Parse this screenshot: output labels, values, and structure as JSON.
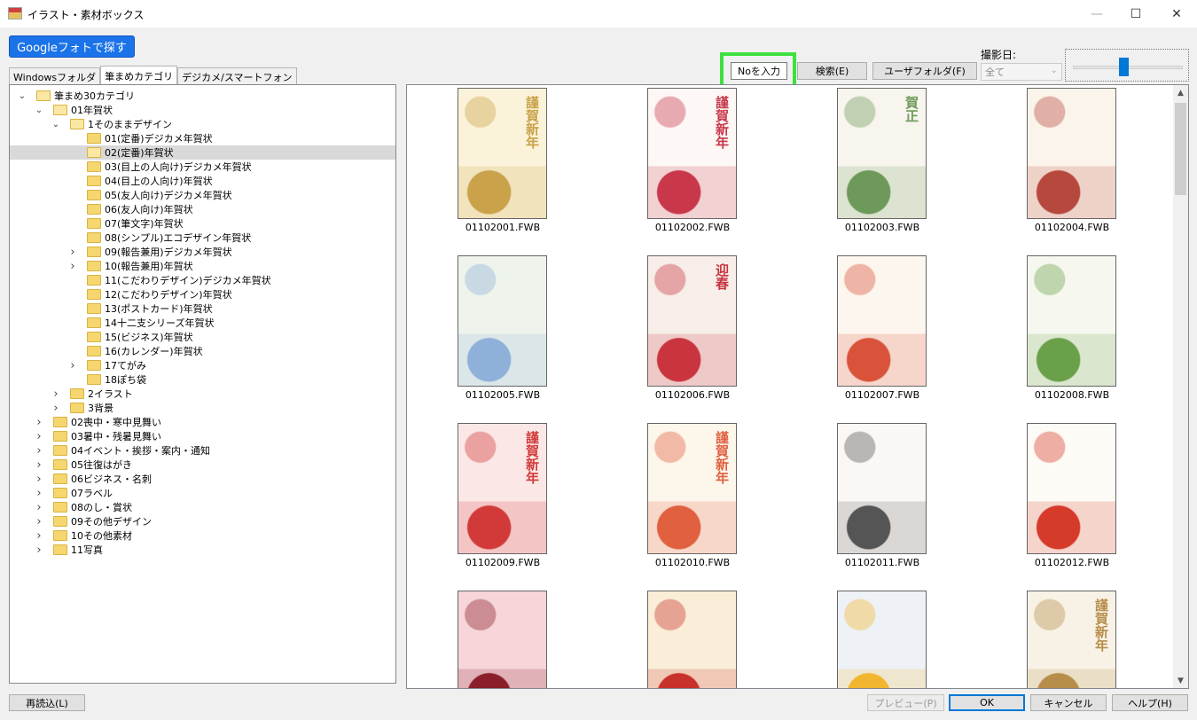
{
  "window": {
    "title": "イラスト・素材ボックス",
    "minimize": "—",
    "maximize": "☐",
    "close": "✕"
  },
  "google_button": "Googleフォトで探す",
  "tabs": [
    {
      "label": "Windowsフォルダ"
    },
    {
      "label": "筆まめカテゴリ"
    },
    {
      "label": "デジカメ/スマートフォン"
    }
  ],
  "toolbar": {
    "no_input_value": "Noを入力",
    "search_label": "検索(E)",
    "userfolder_label": "ユーザフォルダ(F)",
    "date_label": "撮影日:",
    "date_value": "全て",
    "highlight_color": "#3ee03e"
  },
  "tree": [
    {
      "label": "筆まめ30カテゴリ",
      "level": 0,
      "expanded": true
    },
    {
      "label": "01年賀状",
      "level": 1,
      "expanded": true
    },
    {
      "label": "1そのままデザイン",
      "level": 2,
      "expanded": true
    },
    {
      "label": "01(定番)デジカメ年賀状",
      "level": 3
    },
    {
      "label": "02(定番)年賀状",
      "level": 3,
      "selected": true
    },
    {
      "label": "03(目上の人向け)デジカメ年賀状",
      "level": 3
    },
    {
      "label": "04(目上の人向け)年賀状",
      "level": 3
    },
    {
      "label": "05(友人向け)デジカメ年賀状",
      "level": 3
    },
    {
      "label": "06(友人向け)年賀状",
      "level": 3
    },
    {
      "label": "07(筆文字)年賀状",
      "level": 3
    },
    {
      "label": "08(シンプル)エコデザイン年賀状",
      "level": 3
    },
    {
      "label": "09(報告兼用)デジカメ年賀状",
      "level": 3,
      "expandable": true
    },
    {
      "label": "10(報告兼用)年賀状",
      "level": 3,
      "expandable": true
    },
    {
      "label": "11(こだわりデザイン)デジカメ年賀状",
      "level": 3
    },
    {
      "label": "12(こだわりデザイン)年賀状",
      "level": 3
    },
    {
      "label": "13(ポストカード)年賀状",
      "level": 3
    },
    {
      "label": "14十二支シリーズ年賀状",
      "level": 3
    },
    {
      "label": "15(ビジネス)年賀状",
      "level": 3
    },
    {
      "label": "16(カレンダー)年賀状",
      "level": 3
    },
    {
      "label": "17てがみ",
      "level": 3,
      "expandable": true
    },
    {
      "label": "18ぽち袋",
      "level": 3
    },
    {
      "label": "2イラスト",
      "level": 2,
      "expandable": true
    },
    {
      "label": "3背景",
      "level": 2,
      "expandable": true
    },
    {
      "label": "02喪中・寒中見舞い",
      "level": 1,
      "expandable": true
    },
    {
      "label": "03暑中・残暑見舞い",
      "level": 1,
      "expandable": true
    },
    {
      "label": "04イベント・挨拶・案内・通知",
      "level": 1,
      "expandable": true
    },
    {
      "label": "05往復はがき",
      "level": 1,
      "expandable": true
    },
    {
      "label": "06ビジネス・名刺",
      "level": 1,
      "expandable": true
    },
    {
      "label": "07ラベル",
      "level": 1,
      "expandable": true
    },
    {
      "label": "08のし・賞状",
      "level": 1,
      "expandable": true
    },
    {
      "label": "09その他デザイン",
      "level": 1,
      "expandable": true
    },
    {
      "label": "10その他素材",
      "level": 1,
      "expandable": true
    },
    {
      "label": "11写真",
      "level": 1,
      "expandable": true
    }
  ],
  "thumbnails": [
    {
      "name": "01102001.FWB",
      "title": "謹賀新年",
      "bg": "#fbf3d9",
      "accent": "#c9a24a"
    },
    {
      "name": "01102002.FWB",
      "title": "謹賀新年",
      "bg": "#fdf7f5",
      "accent": "#c8384a"
    },
    {
      "name": "01102003.FWB",
      "title": "賀正",
      "bg": "#f7f5ee",
      "accent": "#6d9a5a"
    },
    {
      "name": "01102004.FWB",
      "title": "",
      "bg": "#fbf4ea",
      "accent": "#b7483e"
    },
    {
      "name": "01102005.FWB",
      "title": "",
      "bg": "#eef4ec",
      "accent": "#8fb0d8"
    },
    {
      "name": "01102006.FWB",
      "title": "迎春",
      "bg": "#f8eee9",
      "accent": "#c9343f"
    },
    {
      "name": "01102007.FWB",
      "title": "",
      "bg": "#fdf6ee",
      "accent": "#d8533a"
    },
    {
      "name": "01102008.FWB",
      "title": "",
      "bg": "#f6f8ef",
      "accent": "#6aa04a"
    },
    {
      "name": "01102009.FWB",
      "title": "謹賀新年",
      "bg": "#fbe8e6",
      "accent": "#d23a3a"
    },
    {
      "name": "01102010.FWB",
      "title": "謹賀新年",
      "bg": "#fdf6ea",
      "accent": "#e06040"
    },
    {
      "name": "01102011.FWB",
      "title": "",
      "bg": "#fbf7f4",
      "accent": "#555555"
    },
    {
      "name": "01102012.FWB",
      "title": "",
      "bg": "#fdfbf5",
      "accent": "#d63a2a"
    },
    {
      "name": "",
      "title": "",
      "bg": "#f6d6d9",
      "accent": "#8a1e2a"
    },
    {
      "name": "",
      "title": "",
      "bg": "#faeed8",
      "accent": "#c8302a"
    },
    {
      "name": "",
      "title": "",
      "bg": "#eef2f7",
      "accent": "#f2b52f"
    },
    {
      "name": "",
      "title": "謹賀新年",
      "bg": "#f8f2e6",
      "accent": "#b78d4a"
    }
  ],
  "buttons": {
    "reload": "再読込(L)",
    "preview": "プレビュー(P)",
    "ok": "OK",
    "cancel": "キャンセル",
    "help": "ヘルプ(H)"
  }
}
